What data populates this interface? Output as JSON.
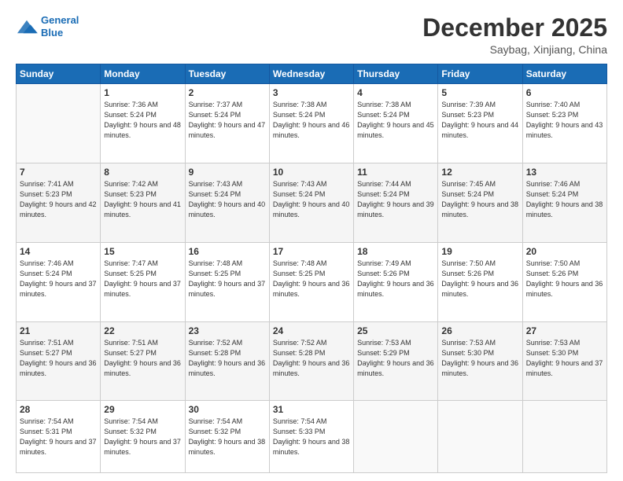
{
  "logo": {
    "line1": "General",
    "line2": "Blue"
  },
  "header": {
    "month": "December 2025",
    "location": "Saybag, Xinjiang, China"
  },
  "days_of_week": [
    "Sunday",
    "Monday",
    "Tuesday",
    "Wednesday",
    "Thursday",
    "Friday",
    "Saturday"
  ],
  "weeks": [
    [
      {
        "num": "",
        "sunrise": "",
        "sunset": "",
        "daylight": ""
      },
      {
        "num": "1",
        "sunrise": "Sunrise: 7:36 AM",
        "sunset": "Sunset: 5:24 PM",
        "daylight": "Daylight: 9 hours and 48 minutes."
      },
      {
        "num": "2",
        "sunrise": "Sunrise: 7:37 AM",
        "sunset": "Sunset: 5:24 PM",
        "daylight": "Daylight: 9 hours and 47 minutes."
      },
      {
        "num": "3",
        "sunrise": "Sunrise: 7:38 AM",
        "sunset": "Sunset: 5:24 PM",
        "daylight": "Daylight: 9 hours and 46 minutes."
      },
      {
        "num": "4",
        "sunrise": "Sunrise: 7:38 AM",
        "sunset": "Sunset: 5:24 PM",
        "daylight": "Daylight: 9 hours and 45 minutes."
      },
      {
        "num": "5",
        "sunrise": "Sunrise: 7:39 AM",
        "sunset": "Sunset: 5:23 PM",
        "daylight": "Daylight: 9 hours and 44 minutes."
      },
      {
        "num": "6",
        "sunrise": "Sunrise: 7:40 AM",
        "sunset": "Sunset: 5:23 PM",
        "daylight": "Daylight: 9 hours and 43 minutes."
      }
    ],
    [
      {
        "num": "7",
        "sunrise": "Sunrise: 7:41 AM",
        "sunset": "Sunset: 5:23 PM",
        "daylight": "Daylight: 9 hours and 42 minutes."
      },
      {
        "num": "8",
        "sunrise": "Sunrise: 7:42 AM",
        "sunset": "Sunset: 5:23 PM",
        "daylight": "Daylight: 9 hours and 41 minutes."
      },
      {
        "num": "9",
        "sunrise": "Sunrise: 7:43 AM",
        "sunset": "Sunset: 5:24 PM",
        "daylight": "Daylight: 9 hours and 40 minutes."
      },
      {
        "num": "10",
        "sunrise": "Sunrise: 7:43 AM",
        "sunset": "Sunset: 5:24 PM",
        "daylight": "Daylight: 9 hours and 40 minutes."
      },
      {
        "num": "11",
        "sunrise": "Sunrise: 7:44 AM",
        "sunset": "Sunset: 5:24 PM",
        "daylight": "Daylight: 9 hours and 39 minutes."
      },
      {
        "num": "12",
        "sunrise": "Sunrise: 7:45 AM",
        "sunset": "Sunset: 5:24 PM",
        "daylight": "Daylight: 9 hours and 38 minutes."
      },
      {
        "num": "13",
        "sunrise": "Sunrise: 7:46 AM",
        "sunset": "Sunset: 5:24 PM",
        "daylight": "Daylight: 9 hours and 38 minutes."
      }
    ],
    [
      {
        "num": "14",
        "sunrise": "Sunrise: 7:46 AM",
        "sunset": "Sunset: 5:24 PM",
        "daylight": "Daylight: 9 hours and 37 minutes."
      },
      {
        "num": "15",
        "sunrise": "Sunrise: 7:47 AM",
        "sunset": "Sunset: 5:25 PM",
        "daylight": "Daylight: 9 hours and 37 minutes."
      },
      {
        "num": "16",
        "sunrise": "Sunrise: 7:48 AM",
        "sunset": "Sunset: 5:25 PM",
        "daylight": "Daylight: 9 hours and 37 minutes."
      },
      {
        "num": "17",
        "sunrise": "Sunrise: 7:48 AM",
        "sunset": "Sunset: 5:25 PM",
        "daylight": "Daylight: 9 hours and 36 minutes."
      },
      {
        "num": "18",
        "sunrise": "Sunrise: 7:49 AM",
        "sunset": "Sunset: 5:26 PM",
        "daylight": "Daylight: 9 hours and 36 minutes."
      },
      {
        "num": "19",
        "sunrise": "Sunrise: 7:50 AM",
        "sunset": "Sunset: 5:26 PM",
        "daylight": "Daylight: 9 hours and 36 minutes."
      },
      {
        "num": "20",
        "sunrise": "Sunrise: 7:50 AM",
        "sunset": "Sunset: 5:26 PM",
        "daylight": "Daylight: 9 hours and 36 minutes."
      }
    ],
    [
      {
        "num": "21",
        "sunrise": "Sunrise: 7:51 AM",
        "sunset": "Sunset: 5:27 PM",
        "daylight": "Daylight: 9 hours and 36 minutes."
      },
      {
        "num": "22",
        "sunrise": "Sunrise: 7:51 AM",
        "sunset": "Sunset: 5:27 PM",
        "daylight": "Daylight: 9 hours and 36 minutes."
      },
      {
        "num": "23",
        "sunrise": "Sunrise: 7:52 AM",
        "sunset": "Sunset: 5:28 PM",
        "daylight": "Daylight: 9 hours and 36 minutes."
      },
      {
        "num": "24",
        "sunrise": "Sunrise: 7:52 AM",
        "sunset": "Sunset: 5:28 PM",
        "daylight": "Daylight: 9 hours and 36 minutes."
      },
      {
        "num": "25",
        "sunrise": "Sunrise: 7:53 AM",
        "sunset": "Sunset: 5:29 PM",
        "daylight": "Daylight: 9 hours and 36 minutes."
      },
      {
        "num": "26",
        "sunrise": "Sunrise: 7:53 AM",
        "sunset": "Sunset: 5:30 PM",
        "daylight": "Daylight: 9 hours and 36 minutes."
      },
      {
        "num": "27",
        "sunrise": "Sunrise: 7:53 AM",
        "sunset": "Sunset: 5:30 PM",
        "daylight": "Daylight: 9 hours and 37 minutes."
      }
    ],
    [
      {
        "num": "28",
        "sunrise": "Sunrise: 7:54 AM",
        "sunset": "Sunset: 5:31 PM",
        "daylight": "Daylight: 9 hours and 37 minutes."
      },
      {
        "num": "29",
        "sunrise": "Sunrise: 7:54 AM",
        "sunset": "Sunset: 5:32 PM",
        "daylight": "Daylight: 9 hours and 37 minutes."
      },
      {
        "num": "30",
        "sunrise": "Sunrise: 7:54 AM",
        "sunset": "Sunset: 5:32 PM",
        "daylight": "Daylight: 9 hours and 38 minutes."
      },
      {
        "num": "31",
        "sunrise": "Sunrise: 7:54 AM",
        "sunset": "Sunset: 5:33 PM",
        "daylight": "Daylight: 9 hours and 38 minutes."
      },
      {
        "num": "",
        "sunrise": "",
        "sunset": "",
        "daylight": ""
      },
      {
        "num": "",
        "sunrise": "",
        "sunset": "",
        "daylight": ""
      },
      {
        "num": "",
        "sunrise": "",
        "sunset": "",
        "daylight": ""
      }
    ]
  ]
}
